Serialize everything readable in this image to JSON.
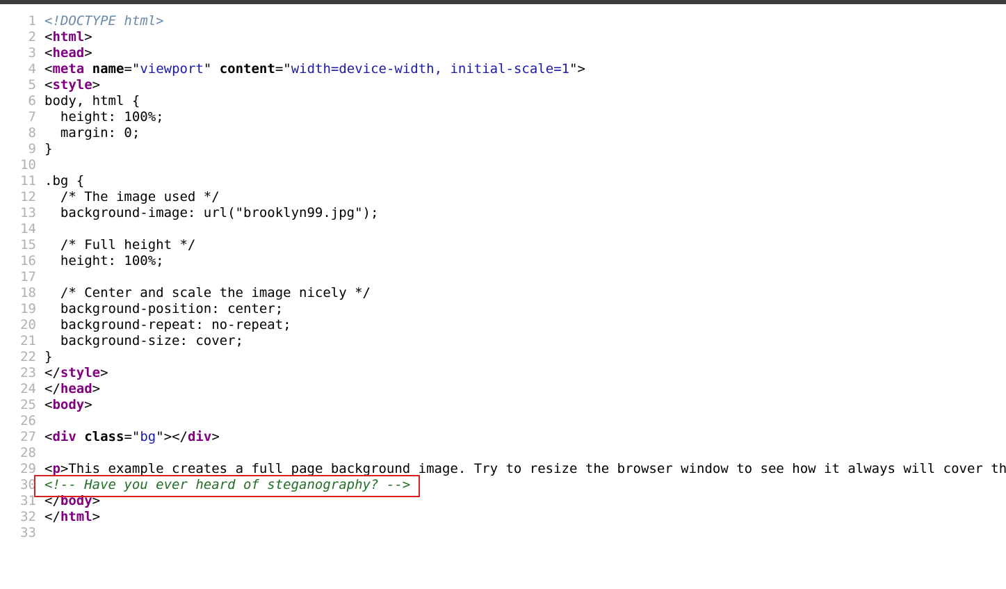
{
  "annotation": {
    "type": "highlight-box",
    "color": "#d71f1f",
    "target_line": 30
  },
  "source": {
    "lines": [
      {
        "num": "1",
        "tokens": [
          {
            "t": "doctype",
            "v": "<!DOCTYPE html>"
          }
        ]
      },
      {
        "num": "2",
        "tokens": [
          {
            "t": "text",
            "v": "<"
          },
          {
            "t": "tag",
            "v": "html"
          },
          {
            "t": "text",
            "v": ">"
          }
        ]
      },
      {
        "num": "3",
        "tokens": [
          {
            "t": "text",
            "v": "<"
          },
          {
            "t": "tag",
            "v": "head"
          },
          {
            "t": "text",
            "v": ">"
          }
        ]
      },
      {
        "num": "4",
        "tokens": [
          {
            "t": "text",
            "v": "<"
          },
          {
            "t": "tag",
            "v": "meta"
          },
          {
            "t": "text",
            "v": " "
          },
          {
            "t": "attr",
            "v": "name"
          },
          {
            "t": "text",
            "v": "=\""
          },
          {
            "t": "value",
            "v": "viewport"
          },
          {
            "t": "text",
            "v": "\" "
          },
          {
            "t": "attr",
            "v": "content"
          },
          {
            "t": "text",
            "v": "=\""
          },
          {
            "t": "value",
            "v": "width=device-width, initial-scale=1"
          },
          {
            "t": "text",
            "v": "\">"
          }
        ]
      },
      {
        "num": "5",
        "tokens": [
          {
            "t": "text",
            "v": "<"
          },
          {
            "t": "tag",
            "v": "style"
          },
          {
            "t": "text",
            "v": ">"
          }
        ]
      },
      {
        "num": "6",
        "tokens": [
          {
            "t": "text",
            "v": "body, html {"
          }
        ]
      },
      {
        "num": "7",
        "tokens": [
          {
            "t": "text",
            "v": "  height: 100%;"
          }
        ]
      },
      {
        "num": "8",
        "tokens": [
          {
            "t": "text",
            "v": "  margin: 0;"
          }
        ]
      },
      {
        "num": "9",
        "tokens": [
          {
            "t": "text",
            "v": "}"
          }
        ]
      },
      {
        "num": "10",
        "tokens": []
      },
      {
        "num": "11",
        "tokens": [
          {
            "t": "text",
            "v": ".bg {"
          }
        ]
      },
      {
        "num": "12",
        "tokens": [
          {
            "t": "text",
            "v": "  /* The image used */"
          }
        ]
      },
      {
        "num": "13",
        "tokens": [
          {
            "t": "text",
            "v": "  background-image: url(\"brooklyn99.jpg\");"
          }
        ]
      },
      {
        "num": "14",
        "tokens": []
      },
      {
        "num": "15",
        "tokens": [
          {
            "t": "text",
            "v": "  /* Full height */"
          }
        ]
      },
      {
        "num": "16",
        "tokens": [
          {
            "t": "text",
            "v": "  height: 100%;"
          }
        ]
      },
      {
        "num": "17",
        "tokens": []
      },
      {
        "num": "18",
        "tokens": [
          {
            "t": "text",
            "v": "  /* Center and scale the image nicely */"
          }
        ]
      },
      {
        "num": "19",
        "tokens": [
          {
            "t": "text",
            "v": "  background-position: center;"
          }
        ]
      },
      {
        "num": "20",
        "tokens": [
          {
            "t": "text",
            "v": "  background-repeat: no-repeat;"
          }
        ]
      },
      {
        "num": "21",
        "tokens": [
          {
            "t": "text",
            "v": "  background-size: cover;"
          }
        ]
      },
      {
        "num": "22",
        "tokens": [
          {
            "t": "text",
            "v": "}"
          }
        ]
      },
      {
        "num": "23",
        "tokens": [
          {
            "t": "text",
            "v": "</"
          },
          {
            "t": "tag",
            "v": "style"
          },
          {
            "t": "text",
            "v": ">"
          }
        ]
      },
      {
        "num": "24",
        "tokens": [
          {
            "t": "text",
            "v": "</"
          },
          {
            "t": "tag",
            "v": "head"
          },
          {
            "t": "text",
            "v": ">"
          }
        ]
      },
      {
        "num": "25",
        "tokens": [
          {
            "t": "text",
            "v": "<"
          },
          {
            "t": "tag",
            "v": "body"
          },
          {
            "t": "text",
            "v": ">"
          }
        ]
      },
      {
        "num": "26",
        "tokens": []
      },
      {
        "num": "27",
        "tokens": [
          {
            "t": "text",
            "v": "<"
          },
          {
            "t": "tag",
            "v": "div"
          },
          {
            "t": "text",
            "v": " "
          },
          {
            "t": "attr",
            "v": "class"
          },
          {
            "t": "text",
            "v": "=\""
          },
          {
            "t": "value",
            "v": "bg"
          },
          {
            "t": "text",
            "v": "\"></"
          },
          {
            "t": "tag",
            "v": "div"
          },
          {
            "t": "text",
            "v": ">"
          }
        ]
      },
      {
        "num": "28",
        "tokens": []
      },
      {
        "num": "29",
        "tokens": [
          {
            "t": "text",
            "v": "<"
          },
          {
            "t": "tag",
            "v": "p"
          },
          {
            "t": "text",
            "v": ">This example creates a full page background image. Try to resize the browser window to see how it always will cover th"
          }
        ]
      },
      {
        "num": "30",
        "tokens": [
          {
            "t": "comment",
            "v": "<!-- Have you ever heard of steganography? -->"
          }
        ]
      },
      {
        "num": "31",
        "tokens": [
          {
            "t": "text",
            "v": "</"
          },
          {
            "t": "tag",
            "v": "body"
          },
          {
            "t": "text",
            "v": ">"
          }
        ]
      },
      {
        "num": "32",
        "tokens": [
          {
            "t": "text",
            "v": "</"
          },
          {
            "t": "tag",
            "v": "html"
          },
          {
            "t": "text",
            "v": ">"
          }
        ]
      },
      {
        "num": "33",
        "tokens": []
      }
    ]
  }
}
